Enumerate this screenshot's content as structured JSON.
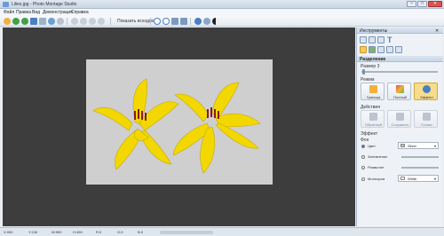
{
  "window": {
    "title": "Lilies.jpg - Photo Montage Studio"
  },
  "menu": [
    "Файл",
    "Правка",
    "Вид",
    "Демонстрация",
    "Справка"
  ],
  "toolbar": {
    "show_original": "Показать исходное"
  },
  "panel": {
    "header": "Инструменты",
    "section_title": "Разделение",
    "size_label": "Размер 3",
    "mode_label": "Режим",
    "modes": [
      "Граница",
      "Полный",
      "Эффект"
    ],
    "actions_label": "Действия",
    "actions": [
      "Обратный",
      "Сохранить",
      "Готово"
    ],
    "effect_label": "Эффект",
    "background_label": "Фон",
    "options": [
      "Цвет",
      "Затемнение",
      "Размытие",
      "Монохром"
    ],
    "color_value": "Silver",
    "mono_value": "White"
  },
  "status": [
    "X:000",
    "Y:130",
    "W:500",
    "H:450",
    "R:0",
    "G:0",
    "B:0"
  ],
  "colors": {
    "accent": "#4a7fc1",
    "canvas": "#3d3d3d",
    "flower": "#f2d800"
  }
}
